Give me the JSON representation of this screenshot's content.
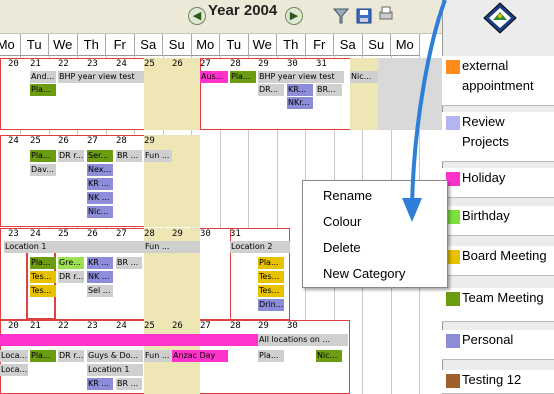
{
  "toolbar": {
    "year_label": "Year 2004",
    "prev_glyph": "◀",
    "next_glyph": "▶"
  },
  "day_headers": [
    "Mo",
    "Tu",
    "We",
    "Th",
    "Fr",
    "Sa",
    "Su",
    "Mo",
    "Tu",
    "We",
    "Th",
    "Fr",
    "Sa",
    "Su",
    "Mo"
  ],
  "rows": {
    "r1": {
      "days": [
        "20",
        "21",
        "22",
        "23",
        "24",
        "25",
        "26",
        "27",
        "28",
        "29",
        "30",
        "31"
      ]
    },
    "r2": {
      "days": [
        "24",
        "25",
        "26",
        "27",
        "28",
        "29"
      ]
    },
    "r3": {
      "days": [
        "23",
        "24",
        "25",
        "26",
        "27",
        "28",
        "29",
        "30",
        "31"
      ]
    },
    "r4": {
      "days": [
        "20",
        "21",
        "22",
        "23",
        "24",
        "25",
        "26",
        "27",
        "28",
        "29",
        "30"
      ]
    }
  },
  "events": {
    "e1": "And...",
    "e2": "BHP year view test",
    "e3": "Pla...",
    "e4": "Aus...",
    "e5": "Pla...",
    "e6": "BHP year view test",
    "e7": "Nic...",
    "e8": "DR...",
    "e9": "KR...",
    "e10": "BR...",
    "e11": "NKr...",
    "e12": "Pla...",
    "e13": "DR r...",
    "e14": "Ser...",
    "e15": "BR ...",
    "e16": "Fun ...",
    "e17": "Dav...",
    "e18": "Nex...",
    "e19": "KR ...",
    "e20": "NK ...",
    "e21": "Nic...",
    "e22": "Location 1",
    "e23": "Fun ...",
    "e24": "Location 2",
    "e25": "Pla...",
    "e26": "Gre...",
    "e27": "KR ...",
    "e28": "BR ...",
    "e29": "Pla...",
    "e30": "Tes...",
    "e31": "DR r...",
    "e32": "NK ...",
    "e33": "Tes...",
    "e34": "Tes...",
    "e35": "Sel ...",
    "e36": "Tes...",
    "e37": "Drin...",
    "e38": "All locations on ...",
    "e39": "Loca...",
    "e40": "Pla...",
    "e41": "DR r...",
    "e42": "Guys & Do...",
    "e43": "Fun ...",
    "e44": "Anzac Day",
    "e45": "Pla...",
    "e46": "Nic...",
    "e47": "Loca...",
    "e48": "Location 1",
    "e49": "KR ...",
    "e50": "BR ..."
  },
  "legend": [
    {
      "label": "external appointment",
      "color": "#ff8c1a"
    },
    {
      "label": "Review Projects",
      "color": "#b4b4f0"
    },
    {
      "label": "Holiday",
      "color": "#ff33cc"
    },
    {
      "label": "Birthday",
      "color": "#7ee040"
    },
    {
      "label": "Board Meeting",
      "color": "#e8c200"
    },
    {
      "label": "Team Meeting",
      "color": "#6c9d10"
    },
    {
      "label": "Personal",
      "color": "#8c8cd8"
    },
    {
      "label": "Testing 12",
      "color": "#a0602a"
    }
  ],
  "context_menu": {
    "items": [
      "Rename",
      "Colour",
      "Delete",
      "New Category"
    ]
  },
  "annotation": {
    "arrow_color": "#2f7fd8"
  }
}
